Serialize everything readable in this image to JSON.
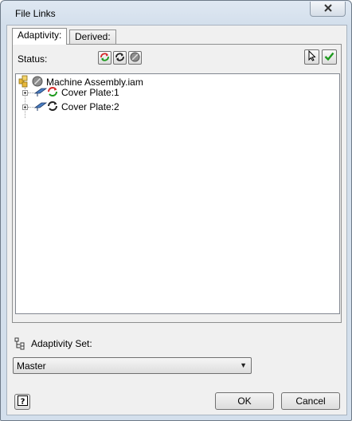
{
  "window": {
    "title": "File Links",
    "close_icon": "close-icon"
  },
  "tabs": [
    {
      "label": "Adaptivity:",
      "active": true
    },
    {
      "label": "Derived:",
      "active": false
    }
  ],
  "status": {
    "label": "Status:",
    "buttons": [
      "update-red-icon",
      "update-black-icon",
      "suppress-icon"
    ],
    "right_buttons": [
      "select-cursor-icon",
      "checkmark-icon"
    ]
  },
  "tree": {
    "root": {
      "label": "Machine Assembly.iam",
      "icon": "assembly-icon"
    },
    "children": [
      {
        "label": "Cover Plate:1",
        "icon": "adaptive-link-red-icon"
      },
      {
        "label": "Cover Plate:2",
        "icon": "adaptive-link-black-icon"
      }
    ]
  },
  "adaptivity_set": {
    "label": "Adaptivity Set:",
    "value": "Master"
  },
  "buttons": {
    "ok": "OK",
    "cancel": "Cancel",
    "help_icon": "help-icon"
  },
  "colors": {
    "accent_red": "#d42a2a",
    "accent_green": "#1e9a1e",
    "folder_yellow": "#e8b83a"
  }
}
